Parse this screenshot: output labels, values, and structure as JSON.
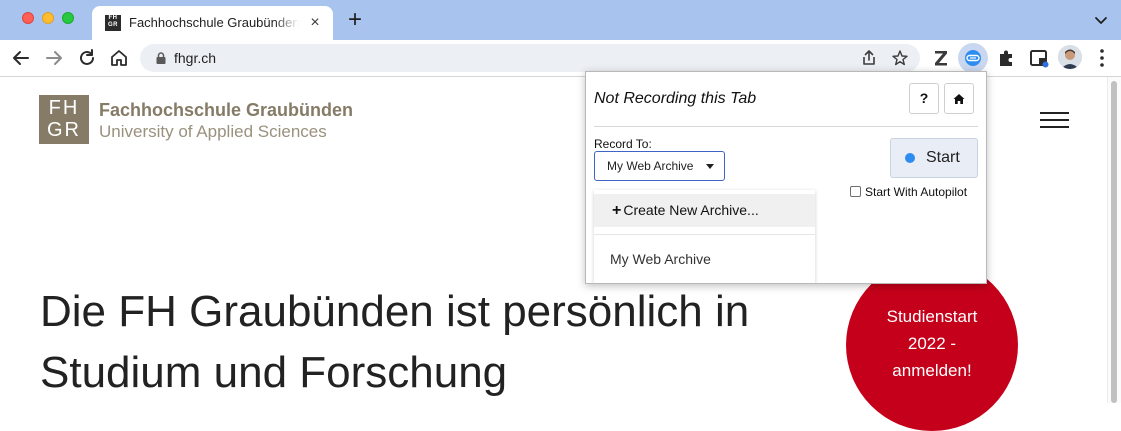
{
  "browser": {
    "tab": {
      "favicon_text_top": "FH",
      "favicon_text_bottom": "GR",
      "title": "Fachhochschule Graubünden - University of Applied Sciences",
      "close_glyph": "×"
    },
    "new_tab_glyph": "+",
    "address": {
      "url": "fhgr.ch"
    },
    "extensions": [
      "zotero-icon",
      "archive-recorder-icon",
      "puzzle-icon",
      "media-router-icon"
    ],
    "profile": "avatar"
  },
  "page": {
    "logo": {
      "box_top": "FH",
      "box_bottom": "GR",
      "name": "Fachhochschule Graubünden",
      "subtitle": "University of Applied Sciences"
    },
    "headline_line1": "Die FH Graubünden ist persönlich in",
    "headline_line2": "Studium und Forschung",
    "cta_line1": "Studienstart",
    "cta_line2": "2022 -",
    "cta_line3": "anmelden!"
  },
  "popup": {
    "title": "Not Recording this Tab",
    "help_label": "?",
    "home_label": "⌂",
    "record_to_label": "Record To:",
    "selected_archive": "My Web Archive",
    "start_label": "Start",
    "autopilot_label": "Start With Autopilot",
    "autopilot_checked": false,
    "dropdown": {
      "create_label": "Create New Archive...",
      "create_prefix": "+",
      "items": [
        "My Web Archive"
      ]
    }
  },
  "colors": {
    "tabbar": "#a8c4ee",
    "brand": "#857b66",
    "cta": "#c5001a",
    "select_border": "#3e64c8",
    "record_dot": "#2d8cf0"
  }
}
